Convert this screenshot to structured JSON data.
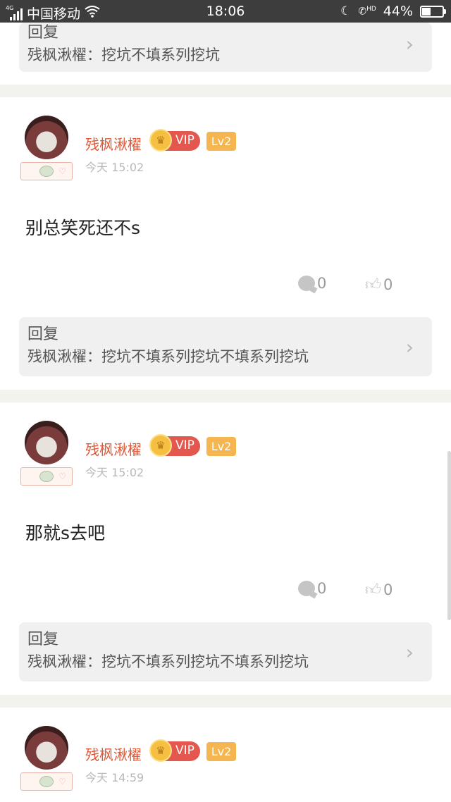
{
  "status_bar": {
    "network_tag": "4G",
    "carrier": "中国移动",
    "time": "18:06",
    "hd_label": "HD",
    "battery": "44%",
    "battery_level": 0.44
  },
  "top_reply": {
    "title": "回复",
    "text": "残枫湫櫂：挖坑不填系列挖坑"
  },
  "posts": [
    {
      "username": "残枫湫櫂",
      "vip_label": "VIP",
      "level": "Lv2",
      "time": "今天 15:02",
      "content": "别总笑死还不s",
      "comment_count": "0",
      "like_count": "0",
      "reply": {
        "title": "回复",
        "text": "残枫湫櫂：挖坑不填系列挖坑不填系列挖坑"
      }
    },
    {
      "username": "残枫湫櫂",
      "vip_label": "VIP",
      "level": "Lv2",
      "time": "今天 15:02",
      "content": "那就s去吧",
      "comment_count": "0",
      "like_count": "0",
      "reply": {
        "title": "回复",
        "text": "残枫湫櫂：挖坑不填系列挖坑不填系列挖坑"
      }
    },
    {
      "username": "残枫湫櫂",
      "vip_label": "VIP",
      "level": "Lv2",
      "time": "今天 14:59"
    }
  ],
  "colors": {
    "username": "#e05a3a",
    "vip_badge": "#e4574f",
    "level_badge": "#f5b651",
    "reply_bg": "#f0f0f0",
    "separator": "#f2f2ee"
  }
}
